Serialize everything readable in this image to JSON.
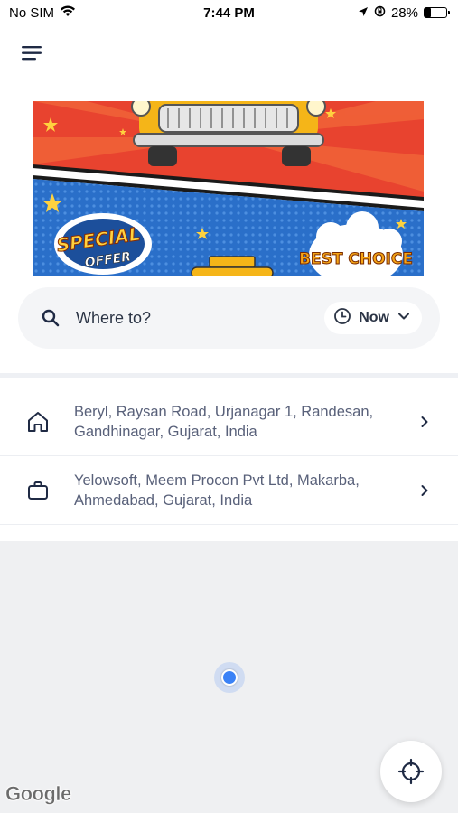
{
  "status_bar": {
    "carrier": "No SIM",
    "time": "7:44 PM",
    "battery_percent": "28%",
    "battery_level": 0.28
  },
  "header": {
    "menu_icon": "hamburger-menu-icon"
  },
  "banner": {
    "badge_left": [
      "SPECIAL",
      "OFFER"
    ],
    "badge_right": "BEST CHOICE",
    "colors": {
      "top": "#e8432f",
      "bottom": "#2a6fc9",
      "taxi": "#f5b518"
    }
  },
  "search": {
    "placeholder": "Where to?",
    "time_option": "Now"
  },
  "saved_places": [
    {
      "icon": "home-icon",
      "address": "Beryl, Raysan Road, Urjanagar 1, Randesan, Gandhinagar, Gujarat, India"
    },
    {
      "icon": "briefcase-icon",
      "address": "Yelowsoft, Meem Procon Pvt Ltd, Makarba, Ahmedabad, Gujarat, India"
    }
  ],
  "map": {
    "attribution": "Google",
    "recenter_icon": "crosshair-icon"
  }
}
